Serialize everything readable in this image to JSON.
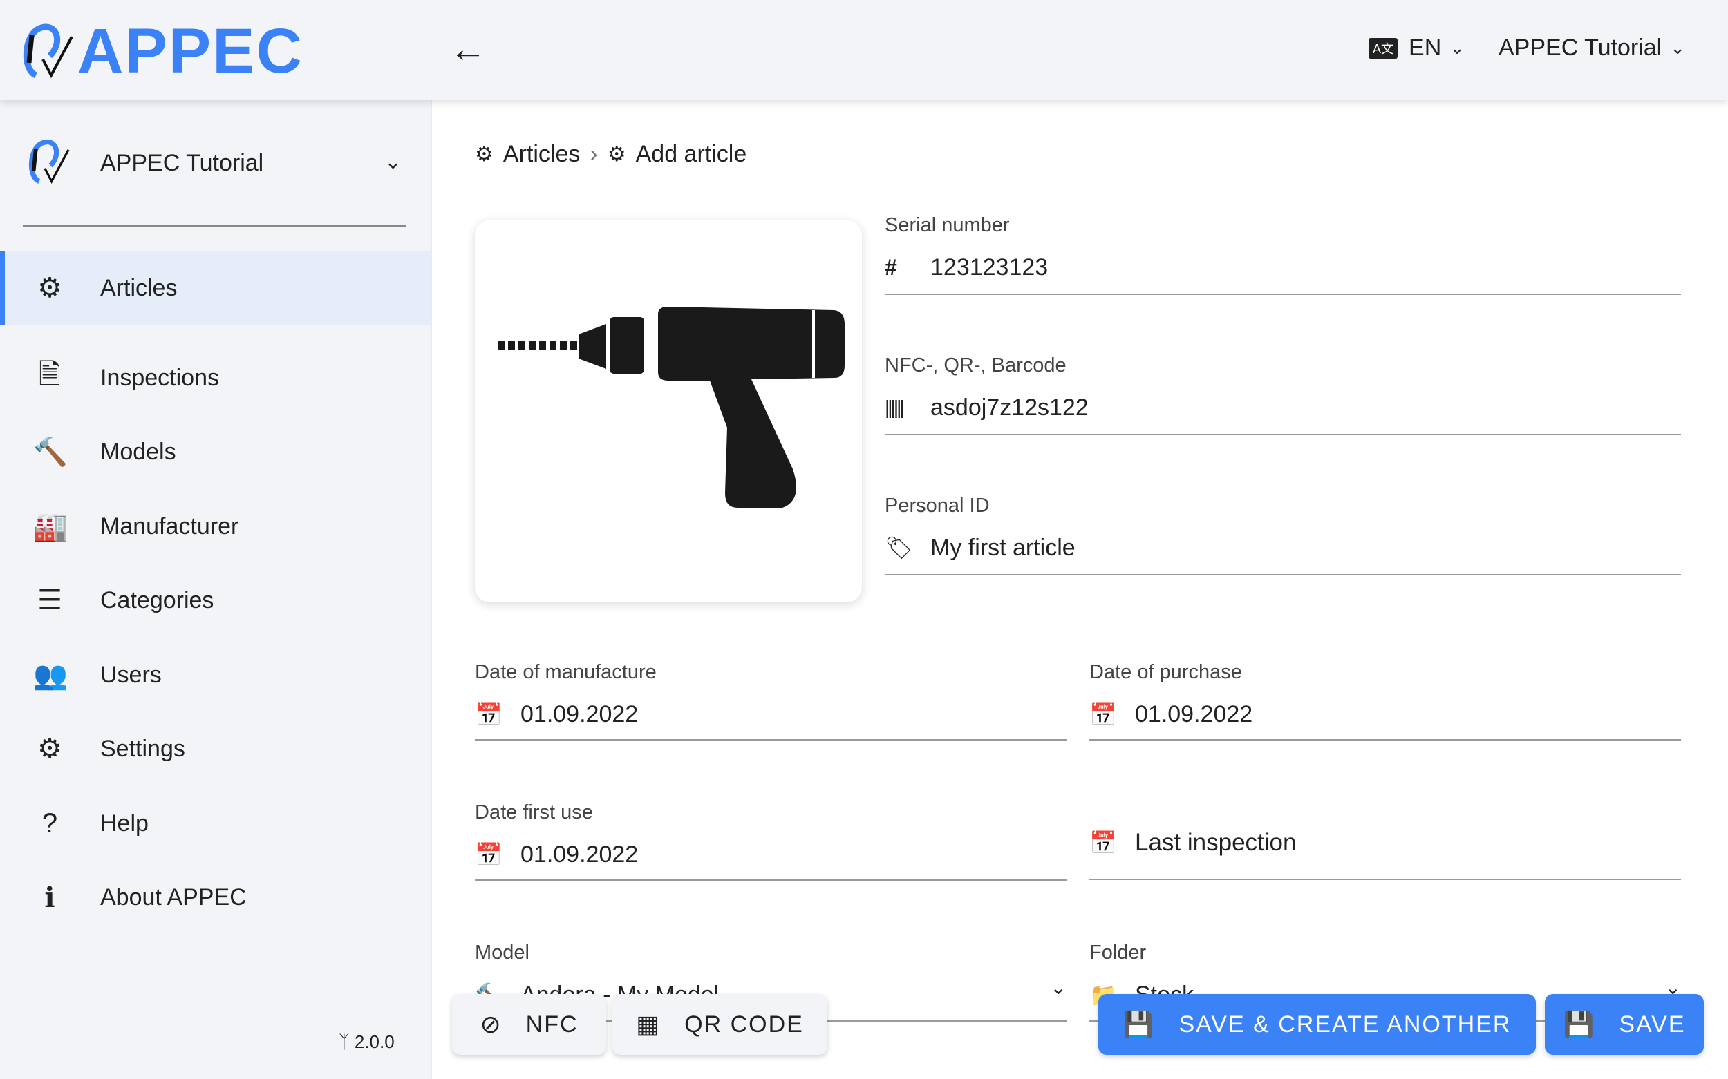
{
  "header": {
    "logo": "APPEC",
    "language": "EN",
    "account": "APPEC Tutorial"
  },
  "sidebar": {
    "org_name": "APPEC Tutorial",
    "org_logo_text": "APPEC",
    "items": [
      {
        "label": "Articles",
        "icon": "carabiner-helmet-icon",
        "active": true
      },
      {
        "label": "Inspections",
        "icon": "document-icon"
      },
      {
        "label": "Models",
        "icon": "hammer-icon"
      },
      {
        "label": "Manufacturer",
        "icon": "factory-icon"
      },
      {
        "label": "Categories",
        "icon": "list-icon"
      },
      {
        "label": "Users",
        "icon": "users-icon"
      },
      {
        "label": "Settings",
        "icon": "gear-icon"
      },
      {
        "label": "Help",
        "icon": "question-icon"
      },
      {
        "label": "About APPEC",
        "icon": "info-icon"
      }
    ],
    "version": "2.0.0"
  },
  "breadcrumb": {
    "items": [
      "Articles",
      "Add article"
    ]
  },
  "form": {
    "serial_number": {
      "label": "Serial number",
      "value": "123123123"
    },
    "code": {
      "label": "NFC-, QR-, Barcode",
      "value": "asdoj7z12s122"
    },
    "personal_id": {
      "label": "Personal ID",
      "value": "My first article"
    },
    "date_manufacture": {
      "label": "Date of manufacture",
      "value": "01.09.2022"
    },
    "date_purchase": {
      "label": "Date of purchase",
      "value": "01.09.2022"
    },
    "date_first_use": {
      "label": "Date first use",
      "value": "01.09.2022"
    },
    "last_inspection": {
      "placeholder": "Last inspection"
    },
    "model": {
      "label": "Model",
      "value": "Andora - My Model"
    },
    "folder": {
      "label": "Folder",
      "value": "Stock"
    }
  },
  "actions": {
    "nfc": "NFC",
    "qr": "QR CODE",
    "save_create": "SAVE & CREATE ANOTHER",
    "save": "SAVE"
  },
  "colors": {
    "accent": "#3b82f6",
    "sidebar_bg": "#f3f4f8",
    "active_bg": "#e6ecf8"
  }
}
